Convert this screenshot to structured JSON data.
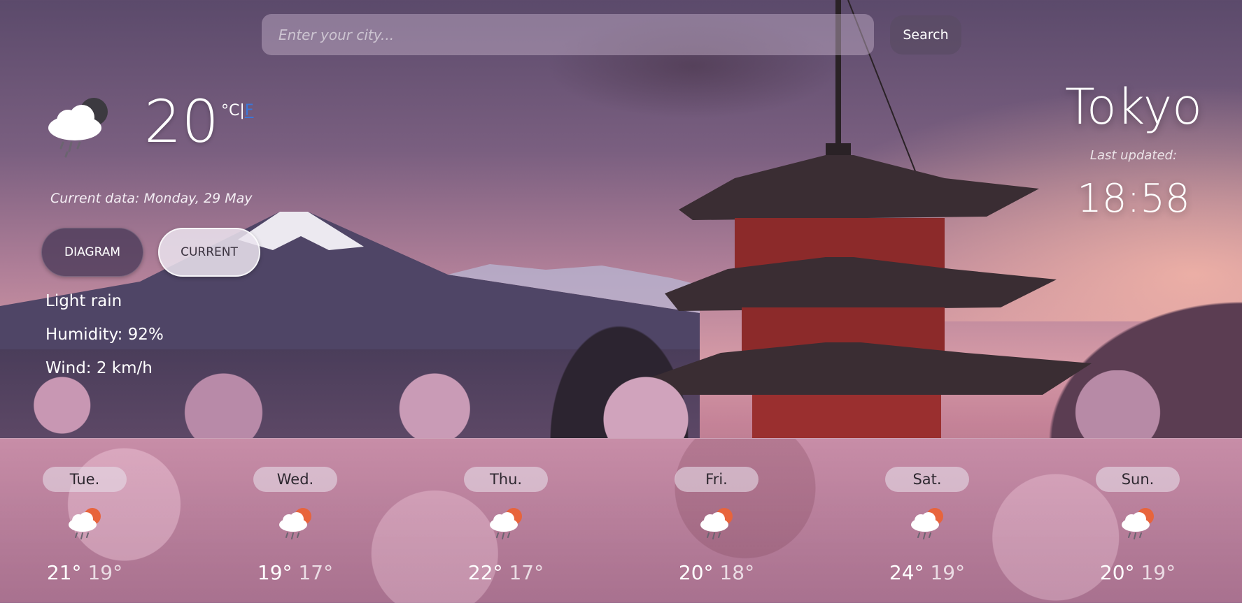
{
  "search": {
    "placeholder": "Enter your city...",
    "button_label": "Search"
  },
  "current": {
    "temperature": "20",
    "unit_celsius": "°C",
    "unit_separator": "|",
    "unit_fahrenheit": "F",
    "date_text": "Current data: Monday, 29 May",
    "icon": "cloud-rain-moon-icon",
    "description": "Light rain",
    "humidity": "Humidity: 92%",
    "wind": "Wind: 2 km/h"
  },
  "view_toggle": {
    "diagram_label": "DIAGRAM",
    "current_label": "CURRENT",
    "active": "current"
  },
  "location": {
    "city": "Tokyo",
    "last_updated_label": "Last updated:",
    "time": "18:58"
  },
  "forecast": [
    {
      "day": "Tue.",
      "max": "21°",
      "min": "19°",
      "icon": "cloud-sun-rain-icon"
    },
    {
      "day": "Wed.",
      "max": "19°",
      "min": "17°",
      "icon": "cloud-sun-rain-icon"
    },
    {
      "day": "Thu.",
      "max": "22°",
      "min": "17°",
      "icon": "cloud-sun-rain-icon"
    },
    {
      "day": "Fri.",
      "max": "20°",
      "min": "18°",
      "icon": "cloud-sun-rain-icon"
    },
    {
      "day": "Sat.",
      "max": "24°",
      "min": "19°",
      "icon": "cloud-sun-rain-icon"
    },
    {
      "day": "Sun.",
      "max": "20°",
      "min": "19°",
      "icon": "cloud-sun-rain-icon"
    }
  ],
  "colors": {
    "accent_link": "#3b76d8",
    "sun": "#e8643c"
  }
}
